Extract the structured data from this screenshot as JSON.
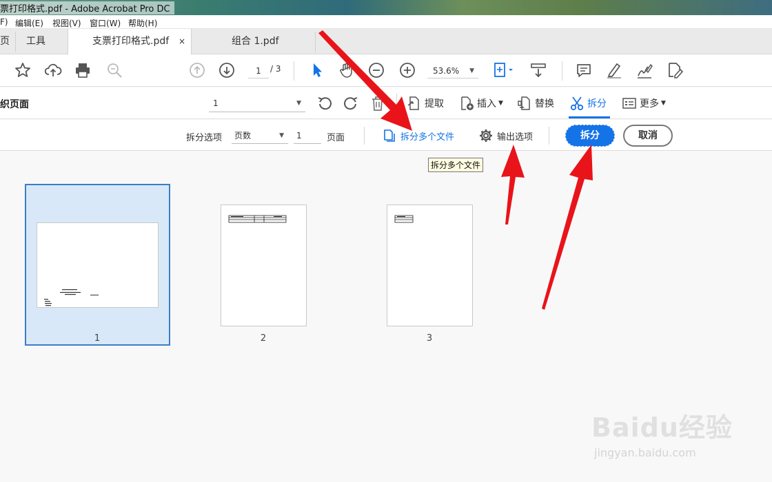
{
  "window": {
    "title": "票打印格式.pdf - Adobe Acrobat Pro DC"
  },
  "menu": [
    {
      "label": "F)"
    },
    {
      "label": "编辑(E)"
    },
    {
      "label": "视图(V)"
    },
    {
      "label": "窗口(W)"
    },
    {
      "label": "帮助(H)"
    }
  ],
  "tabs": {
    "home": "页",
    "tools": "工具",
    "doc1": "支票打印格式.pdf",
    "doc2": "组合 1.pdf",
    "close": "×"
  },
  "toolbar": {
    "page_current": "1",
    "page_total": "/ 3",
    "zoom": "53.6%",
    "icons": [
      "star-icon",
      "cloud-upload-icon",
      "print-icon",
      "zoom-search-icon",
      "page-up-icon",
      "page-down-icon",
      "select-cursor-icon",
      "hand-icon",
      "zoom-out-icon",
      "zoom-in-icon",
      "fit-page-icon",
      "scroll-mode-icon",
      "comment-icon",
      "highlight-icon",
      "sign-icon",
      "fill-sign-icon"
    ]
  },
  "organize": {
    "title": "织页面",
    "page_range": "1",
    "tools": {
      "extract": "提取",
      "insert": "插入",
      "replace": "替换",
      "split": "拆分",
      "more": "更多"
    }
  },
  "split": {
    "options_label": "拆分选项",
    "mode": "页数",
    "count": "1",
    "unit": "页面",
    "multi_files": "拆分多个文件",
    "output_options": "输出选项",
    "split_button": "拆分",
    "cancel_button": "取消"
  },
  "tooltip": "拆分多个文件",
  "pages": [
    {
      "number": "1",
      "selected": true
    },
    {
      "number": "2",
      "selected": false
    },
    {
      "number": "3",
      "selected": false
    }
  ],
  "watermark": {
    "brand": "Baidu经验",
    "url": "jingyan.baidu.com"
  },
  "colors": {
    "accent": "#1473e6",
    "arrow": "#e8141a",
    "selection": "#d8e8f8"
  }
}
